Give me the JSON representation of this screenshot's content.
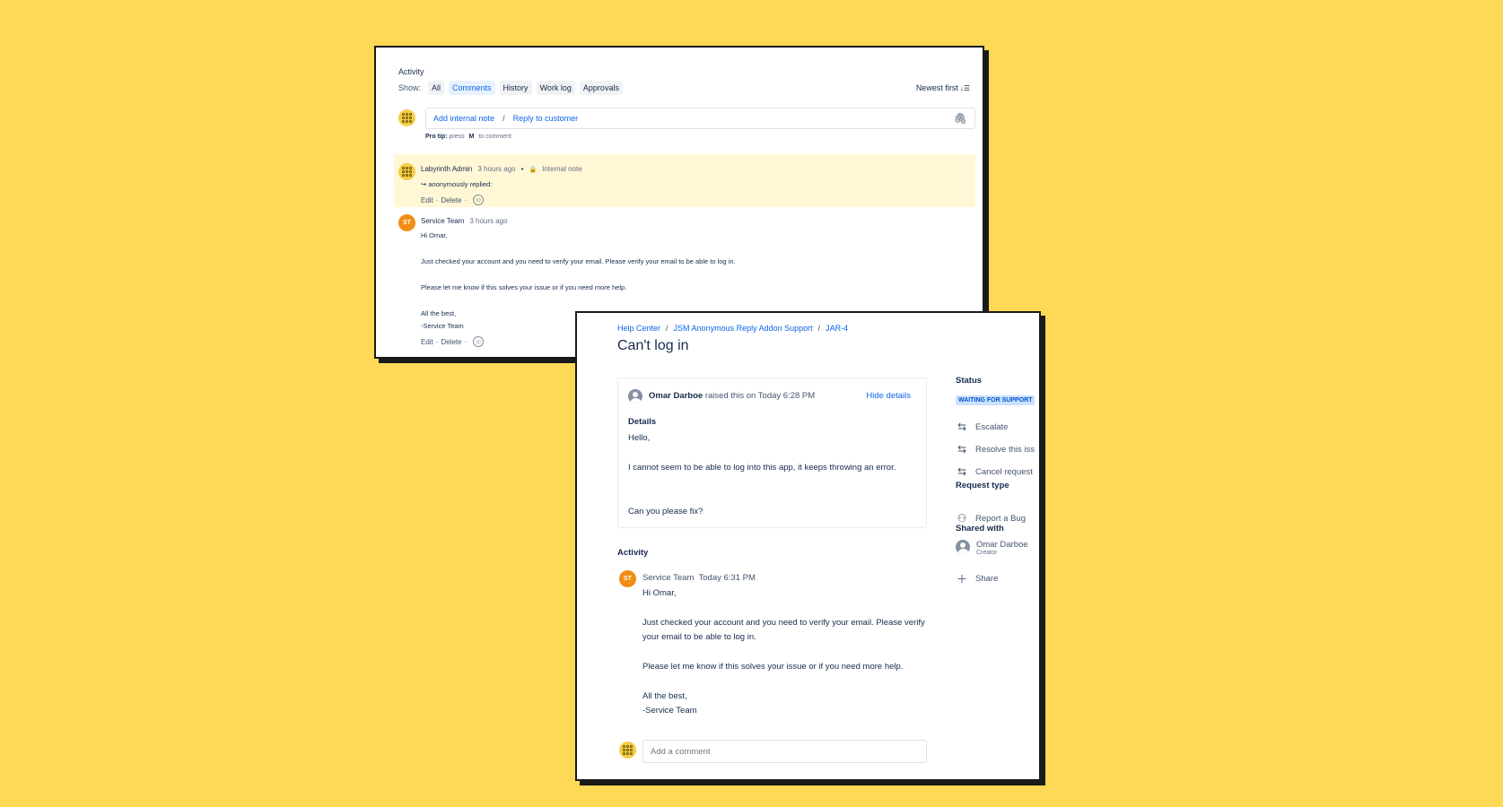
{
  "agent_view": {
    "activity_title": "Activity",
    "show_label": "Show:",
    "filters": [
      "All",
      "Comments",
      "History",
      "Work log",
      "Approvals"
    ],
    "active_filter": "Comments",
    "sort_label": "Newest first",
    "sort_icon": "sort-descending-icon",
    "add_internal_note": "Add internal note",
    "separator": "/",
    "reply_to_customer": "Reply to customer",
    "attach_icon": "paperclip-icon",
    "pro_tip_label": "Pro tip:",
    "pro_tip_press": "press",
    "pro_tip_key": "M",
    "pro_tip_suffix": "to comment",
    "internal_comment": {
      "author": "Labyrinth Admin",
      "time": "3 hours ago",
      "bullet": "•",
      "lock_icon": "lock-icon",
      "note_label": "Internal note",
      "reply_text": "↪ anonymously replied:",
      "edit": "Edit",
      "delete": "Delete",
      "dot": "·",
      "highlight_color": "#fff7d6"
    },
    "public_comment": {
      "avatar_initials": "ST",
      "author": "Service Team",
      "time": "3 hours ago",
      "lines": [
        "Hi Omar,",
        "Just checked your account and you need to verify your email. Please verify your email to be able to log in.",
        "Please let me know if this solves your issue or if you need more help.",
        "All the best,",
        "-Service Team"
      ],
      "edit": "Edit",
      "delete": "Delete",
      "dot": "·"
    }
  },
  "portal_view": {
    "breadcrumb": [
      "Help Center",
      "JSM Anonymous Reply Addon Support",
      "JAR-4"
    ],
    "breadcrumb_sep": "/",
    "title": "Can't log in",
    "requester": "Omar Darboe",
    "raised_text": "raised this on Today 6:28 PM",
    "hide_details": "Hide details",
    "details_label": "Details",
    "details_lines": [
      "Hello,",
      "I cannot seem to be able to log into this app, it keeps throwing an error.",
      "Can you please fix?"
    ],
    "activity_heading": "Activity",
    "comment": {
      "avatar_initials": "ST",
      "author": "Service Team",
      "time": "Today 6:31 PM",
      "lines": [
        "Hi Omar,",
        "Just checked your account and you need to verify your email. Please verify",
        "your email to be able to log in.",
        "Please let me know if this solves your issue or if you need more help.",
        "All the best,",
        "-Service Team"
      ]
    },
    "add_comment_placeholder": "Add a comment",
    "sidebar": {
      "status_label": "Status",
      "status_value": "WAITING FOR SUPPORT",
      "status_color": "#cce0ff",
      "actions": [
        {
          "label": "Escalate",
          "icon": "transition-arrows-icon"
        },
        {
          "label": "Resolve this iss",
          "icon": "transition-arrows-icon"
        },
        {
          "label": "Cancel request",
          "icon": "transition-arrows-icon"
        }
      ],
      "request_type_label": "Request type",
      "request_type_value": "Report a Bug",
      "request_type_icon": "bug-report-icon",
      "shared_with_label": "Shared with",
      "shared_person": "Omar Darboe",
      "shared_role": "Creator",
      "share_label": "Share",
      "share_icon": "plus-icon"
    }
  },
  "colors": {
    "background": "#fdd955",
    "link": "#0c66e4",
    "avatar_st": "#f18d13",
    "avatar_lab": "#f5cd47"
  }
}
